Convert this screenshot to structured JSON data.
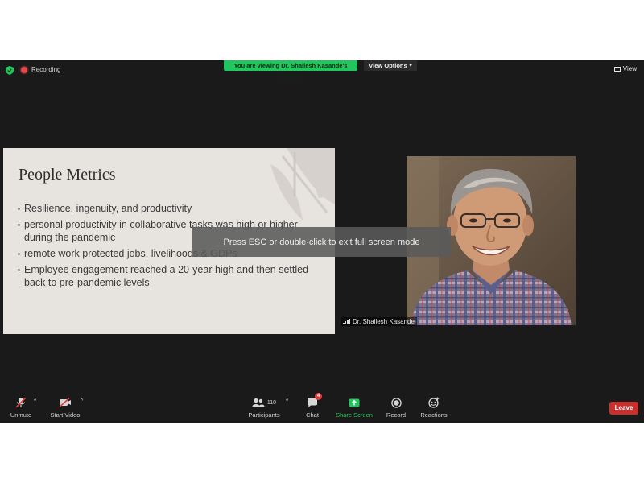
{
  "topbar": {
    "recording_label": "Recording",
    "viewing_banner": "You are viewing Dr. Shailesh Kasande's screen",
    "view_options_label": "View Options",
    "view_label": "View"
  },
  "slide": {
    "title": "People Metrics",
    "bullets": [
      "Resilience, ingenuity, and productivity",
      "personal productivity in collaborative tasks was high or higher during the pandemic",
      "remote work protected jobs, livelihoods & GDPs",
      "Employee engagement reached a 20-year high  and then settled back to pre-pandemic levels"
    ]
  },
  "overlay": {
    "esc_message": "Press ESC or double-click to exit full screen mode"
  },
  "participant": {
    "name": "Dr. Shailesh Kasande"
  },
  "toolbar": {
    "unmute_label": "Unmute",
    "start_video_label": "Start Video",
    "participants_label": "Participants",
    "participants_count": "110",
    "chat_label": "Chat",
    "chat_badge": "4",
    "share_screen_label": "Share Screen",
    "record_label": "Record",
    "reactions_label": "Reactions",
    "leave_label": "Leave"
  },
  "colors": {
    "window_bg": "#1a1a1a",
    "banner_green": "#22c55e",
    "recording_red": "#e04b4b",
    "leave_red": "#c9302c",
    "slide_bg": "#e7e3df"
  },
  "icons": [
    "shield-check-icon",
    "record-dot-icon",
    "chevron-down-icon",
    "view-grid-icon",
    "microphone-muted-icon",
    "video-muted-icon",
    "participants-icon",
    "chat-bubble-icon",
    "share-screen-arrow-icon",
    "record-circle-icon",
    "reactions-emoji-icon",
    "signal-bars-icon"
  ]
}
